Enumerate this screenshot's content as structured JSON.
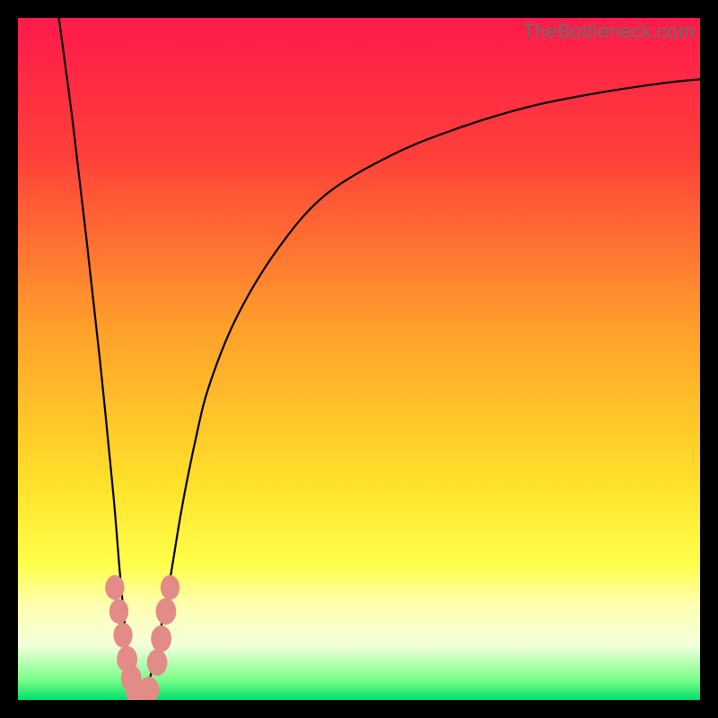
{
  "watermark": "TheBottleneck.com",
  "chart_data": {
    "type": "line",
    "title": "",
    "xlabel": "",
    "ylabel": "",
    "xlim": [
      0,
      100
    ],
    "ylim": [
      0,
      100
    ],
    "gradient_stops": [
      {
        "offset": 0,
        "color": "#ff1a4b"
      },
      {
        "offset": 20,
        "color": "#ff3f3a"
      },
      {
        "offset": 45,
        "color": "#ff9e2b"
      },
      {
        "offset": 68,
        "color": "#ffe02a"
      },
      {
        "offset": 80,
        "color": "#ffff4a"
      },
      {
        "offset": 86,
        "color": "#ffffb0"
      },
      {
        "offset": 92,
        "color": "#f3ffda"
      },
      {
        "offset": 97,
        "color": "#7cff8a"
      },
      {
        "offset": 100,
        "color": "#00e06b"
      }
    ],
    "series": [
      {
        "name": "bottleneck-curve",
        "x": [
          6,
          8,
          10,
          12,
          14,
          15,
          16,
          17,
          18,
          19,
          20,
          22,
          24,
          26,
          28,
          32,
          38,
          45,
          55,
          65,
          75,
          85,
          95,
          100
        ],
        "y": [
          100,
          85,
          68,
          50,
          30,
          18,
          8,
          2,
          0,
          2,
          6,
          16,
          28,
          38,
          46,
          56,
          66,
          74,
          80,
          84,
          87,
          89,
          90.5,
          91
        ]
      }
    ],
    "markers": [
      {
        "x": 14.2,
        "y": 16.5,
        "r": 1.4
      },
      {
        "x": 14.8,
        "y": 13.0,
        "r": 1.4
      },
      {
        "x": 15.4,
        "y": 9.5,
        "r": 1.4
      },
      {
        "x": 16.0,
        "y": 6.0,
        "r": 1.5
      },
      {
        "x": 16.6,
        "y": 3.2,
        "r": 1.5
      },
      {
        "x": 17.3,
        "y": 1.2,
        "r": 1.5
      },
      {
        "x": 18.2,
        "y": 0.4,
        "r": 1.6
      },
      {
        "x": 19.2,
        "y": 1.5,
        "r": 1.5
      },
      {
        "x": 20.4,
        "y": 5.5,
        "r": 1.5
      },
      {
        "x": 21.0,
        "y": 9.0,
        "r": 1.5
      },
      {
        "x": 21.7,
        "y": 13.0,
        "r": 1.5
      },
      {
        "x": 22.3,
        "y": 16.5,
        "r": 1.4
      }
    ]
  }
}
